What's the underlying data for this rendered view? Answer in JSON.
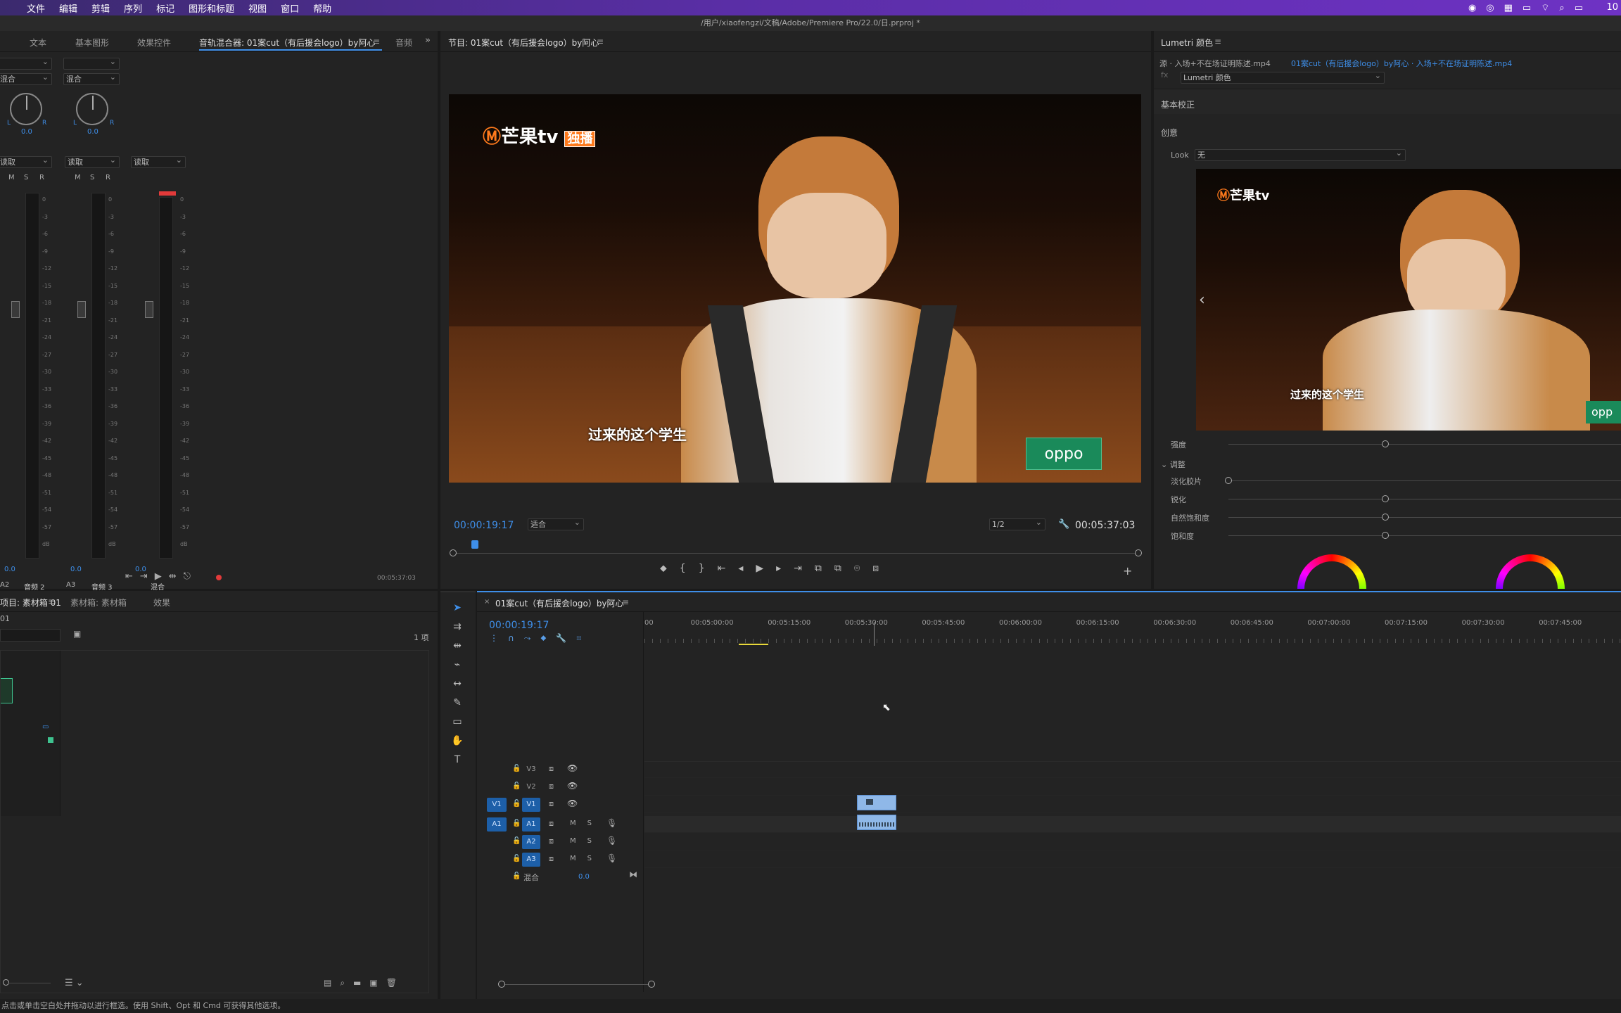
{
  "menubar": {
    "items": [
      "文件",
      "编辑",
      "剪辑",
      "序列",
      "标记",
      "图形和标题",
      "视图",
      "窗口",
      "帮助"
    ],
    "clock": "10"
  },
  "titlebar": {
    "path": "/用户/xiaofengzi/文稿/Adobe/Premiere Pro/22.0/日.prproj *"
  },
  "left_panel": {
    "tabs": [
      "文本",
      "基本图形",
      "效果控件",
      "音轨混合器: 01案cut（有后援会logo）by阿心",
      "音频"
    ],
    "channels": [
      {
        "mode": "混合",
        "read": "读取",
        "pan": "0.0",
        "vol": "0.0",
        "label_id": "A2",
        "label_name": "音频 2"
      },
      {
        "mode": "混合",
        "read": "读取",
        "pan": "0.0",
        "vol": "0.0",
        "label_id": "A3",
        "label_name": "音频 3"
      },
      {
        "mode": "",
        "read": "读取",
        "pan": "",
        "vol": "0.0",
        "label_id": "",
        "label_name": "混合"
      }
    ],
    "db_scale": [
      "0",
      "-3",
      "-6",
      "-9",
      "-12",
      "-15",
      "-18",
      "-21",
      "-24",
      "-27",
      "-30",
      "-33",
      "-36",
      "-39",
      "-42",
      "-45",
      "-48",
      "-51",
      "-54",
      "-57",
      "dB"
    ],
    "timecode": "00:05:37:03",
    "msr": [
      "M",
      "S",
      "R"
    ]
  },
  "program_monitor": {
    "tab": "节目: 01案cut（有后援会logo）by阿心",
    "timecode_current": "00:00:19:17",
    "fit": "适合",
    "quality": "1/2",
    "timecode_duration": "00:05:37:03",
    "subtitle": "过来的这个学生",
    "logo_text": "芒果tv",
    "logo_badge": "独播",
    "sponsor": "oppo"
  },
  "lumetri": {
    "title": "Lumetri 颜色",
    "source": "源 · 入场+不在场证明陈述.mp4",
    "sequence_clip": "01案cut（有后援会logo）by阿心 · 入场+不在场证明陈述.mp4",
    "effect": "Lumetri 颜色",
    "basic": "基本校正",
    "creative": "创意",
    "look_label": "Look",
    "look_value": "无",
    "intensity": "强度",
    "adjust": "调整",
    "adjust_items": [
      {
        "label": "淡化胶片",
        "value": 0
      },
      {
        "label": "锐化",
        "value": 0.5
      },
      {
        "label": "自然饱和度",
        "value": 0.5
      },
      {
        "label": "饱和度",
        "value": 0.5
      }
    ],
    "intensity_value": 0.5,
    "preview_subtitle": "过来的这个学生",
    "preview_sponsor": "opp"
  },
  "project_panel": {
    "tabs": [
      "项目: 素材箱 01",
      "素材箱: 素材箱",
      "效果"
    ],
    "subtitle": "01",
    "count": "1 项",
    "status": "点击或单击空白处并拖动以进行框选。使用 Shift、Opt 和 Cmd 可获得其他选项。"
  },
  "timeline": {
    "tab": "01案cut（有后援会logo）by阿心",
    "timecode": "00:00:19:17",
    "ruler": [
      "00",
      "00:05:00:00",
      "00:05:15:00",
      "00:05:30:00",
      "00:05:45:00",
      "00:06:00:00",
      "00:06:15:00",
      "00:06:30:00",
      "00:06:45:00",
      "00:07:00:00",
      "00:07:15:00",
      "00:07:30:00",
      "00:07:45:00"
    ],
    "video_tracks": [
      "V3",
      "V2",
      "V1"
    ],
    "audio_tracks": [
      "A1",
      "A2",
      "A3"
    ],
    "mix_label": "混合",
    "mix_value": "0.0",
    "source_v": "V1",
    "source_a": "A1"
  }
}
